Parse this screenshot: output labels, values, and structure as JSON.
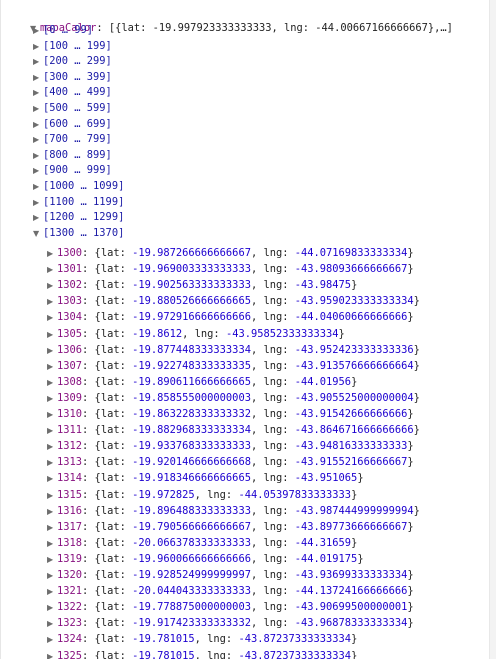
{
  "root": {
    "key": "mapaCalor",
    "summary": "[{lat: -19.997923333333333, lng: -44.00667166666667},…]"
  },
  "groups": [
    "[0 … 99]",
    "[100 … 199]",
    "[200 … 299]",
    "[300 … 399]",
    "[400 … 499]",
    "[500 … 599]",
    "[600 … 699]",
    "[700 … 799]",
    "[800 … 899]",
    "[900 … 999]",
    "[1000 … 1099]",
    "[1100 … 1199]",
    "[1200 … 1299]",
    "[1300 … 1370]"
  ],
  "entries": [
    {
      "index": "1300",
      "lat": "-19.987266666666667",
      "lng": "-44.07169833333334"
    },
    {
      "index": "1301",
      "lat": "-19.969003333333333",
      "lng": "-43.98093666666667"
    },
    {
      "index": "1302",
      "lat": "-19.902563333333333",
      "lng": "-43.98475"
    },
    {
      "index": "1303",
      "lat": "-19.880526666666665",
      "lng": "-43.959023333333334"
    },
    {
      "index": "1304",
      "lat": "-19.972916666666666",
      "lng": "-44.04060666666666"
    },
    {
      "index": "1305",
      "lat": "-19.8612",
      "lng": "-43.95852333333334"
    },
    {
      "index": "1306",
      "lat": "-19.877448333333334",
      "lng": "-43.952423333333336"
    },
    {
      "index": "1307",
      "lat": "-19.922748333333335",
      "lng": "-43.913576666666664"
    },
    {
      "index": "1308",
      "lat": "-19.890611666666665",
      "lng": "-44.01956"
    },
    {
      "index": "1309",
      "lat": "-19.858555000000003",
      "lng": "-43.905525000000004"
    },
    {
      "index": "1310",
      "lat": "-19.863228333333332",
      "lng": "-43.91542666666666"
    },
    {
      "index": "1311",
      "lat": "-19.882968333333334",
      "lng": "-43.864671666666666"
    },
    {
      "index": "1312",
      "lat": "-19.933768333333333",
      "lng": "-43.94816333333333"
    },
    {
      "index": "1313",
      "lat": "-19.920146666666668",
      "lng": "-43.91552166666667"
    },
    {
      "index": "1314",
      "lat": "-19.918346666666665",
      "lng": "-43.951065"
    },
    {
      "index": "1315",
      "lat": "-19.972825",
      "lng": "-44.05397833333333"
    },
    {
      "index": "1316",
      "lat": "-19.896488333333333",
      "lng": "-43.987444999999994"
    },
    {
      "index": "1317",
      "lat": "-19.790566666666667",
      "lng": "-43.89773666666667"
    },
    {
      "index": "1318",
      "lat": "-20.066378333333333",
      "lng": "-44.31659"
    },
    {
      "index": "1319",
      "lat": "-19.960066666666666",
      "lng": "-44.019175"
    },
    {
      "index": "1320",
      "lat": "-19.928524999999997",
      "lng": "-43.93699333333334"
    },
    {
      "index": "1321",
      "lat": "-20.044043333333333",
      "lng": "-44.13724166666666"
    },
    {
      "index": "1322",
      "lat": "-19.778875000000003",
      "lng": "-43.90699500000001"
    },
    {
      "index": "1323",
      "lat": "-19.917423333333332",
      "lng": "-43.96878333333334"
    },
    {
      "index": "1324",
      "lat": "-19.781015",
      "lng": "-43.87237333333334"
    },
    {
      "index": "1325",
      "lat": "-19.781015",
      "lng": "-43.87237333333334"
    }
  ],
  "colors": {
    "key": "#881280",
    "value": "#1a1aa6",
    "triangle": "#6e6e6e"
  },
  "icons": {
    "expanded": "triangle-down-icon",
    "collapsed": "triangle-right-icon"
  }
}
